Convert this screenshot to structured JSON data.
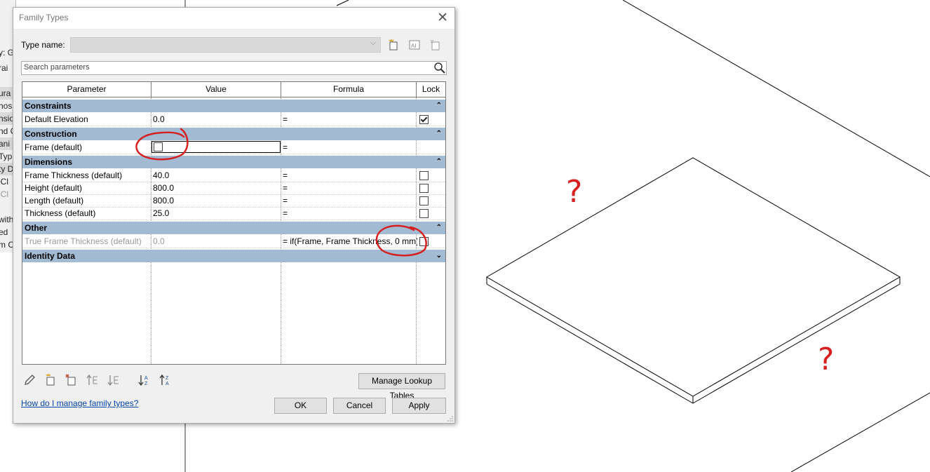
{
  "background": {
    "side_labels": [
      "y: G",
      "rai",
      "ura",
      "hos",
      "nsio",
      "nd C",
      "ani",
      "Typ",
      "ty D",
      "iCl",
      "iCl",
      "with",
      "ed",
      "m C"
    ]
  },
  "dialog": {
    "title": "Family Types",
    "type_name_label": "Type name:",
    "type_name_value": "",
    "search_placeholder": "Search parameters",
    "columns": [
      "Parameter",
      "Value",
      "Formula",
      "Lock"
    ],
    "groups": [
      {
        "name": "Constraints",
        "rows": [
          {
            "param": "Default Elevation",
            "value": "0.0",
            "formula": "=",
            "lock": true
          }
        ]
      },
      {
        "name": "Construction",
        "rows": [
          {
            "param": "Frame (default)",
            "value": "",
            "formula": "=",
            "checkbox_value": false
          }
        ]
      },
      {
        "name": "Dimensions",
        "rows": [
          {
            "param": "Frame Thickness (default)",
            "value": "40.0",
            "formula": "=",
            "lock": false
          },
          {
            "param": "Height (default)",
            "value": "800.0",
            "formula": "=",
            "lock": false
          },
          {
            "param": "Length (default)",
            "value": "800.0",
            "formula": "=",
            "lock": false
          },
          {
            "param": "Thickness (default)",
            "value": "25.0",
            "formula": "=",
            "lock": false
          }
        ]
      },
      {
        "name": "Other",
        "rows": [
          {
            "param": "True Frame Thickness (default)",
            "value": "0.0",
            "formula": "= if(Frame, Frame Thickness, 0 mm)",
            "lock": false
          }
        ]
      },
      {
        "name": "Identity Data",
        "rows": []
      }
    ],
    "manage_lookup_label": "Manage Lookup Tables",
    "help_link": "How do I manage family types?",
    "ok_label": "OK",
    "cancel_label": "Cancel",
    "apply_label": "Apply"
  },
  "annotations": {
    "marks": [
      "?",
      "?"
    ],
    "color": "#d62020"
  }
}
